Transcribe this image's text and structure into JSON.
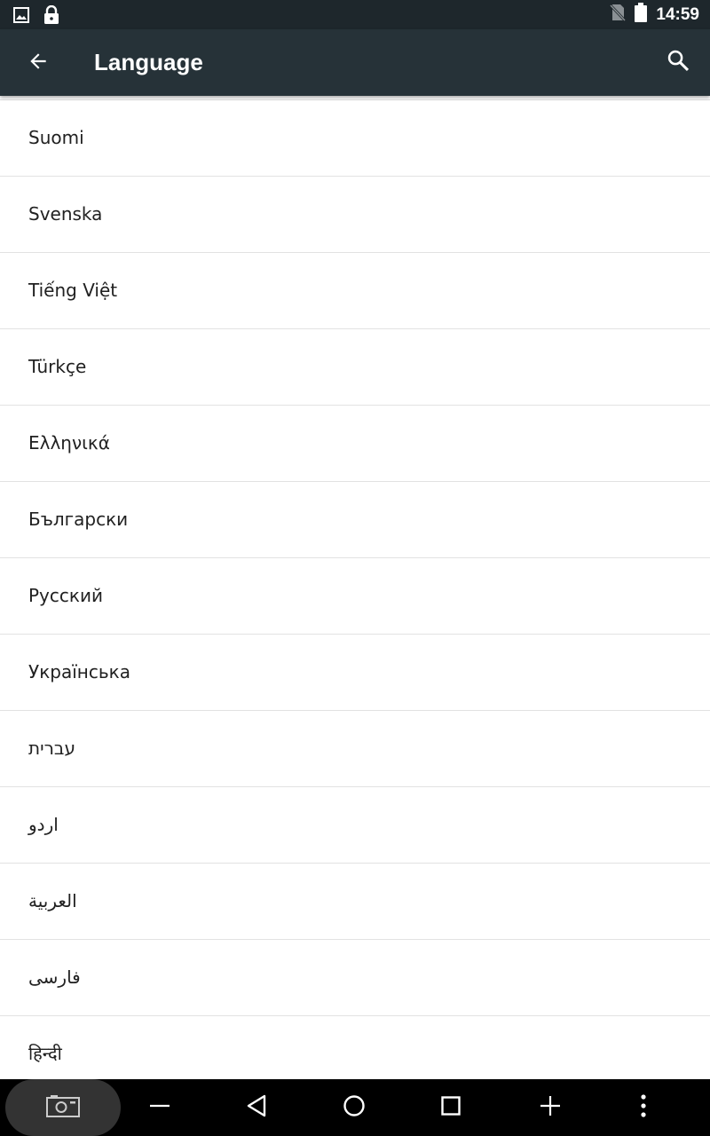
{
  "status_bar": {
    "time": "14:59",
    "left_icons": [
      "image-icon",
      "lock-icon"
    ],
    "right_icons": [
      "no-sim-icon",
      "battery-icon"
    ]
  },
  "app_bar": {
    "title": "Language",
    "back_icon": "arrow-back-icon",
    "search_icon": "search-icon",
    "background": "#263238"
  },
  "languages": [
    "Suomi",
    "Svenska",
    "Tiếng Việt",
    "Türkçe",
    "Ελληνικά",
    "Български",
    "Русский",
    "Українська",
    "עברית",
    "اردو",
    "العربية",
    "فارسی",
    "हिन्दी"
  ],
  "nav_bar": {
    "buttons": [
      "screenshot-icon",
      "volume-down-icon",
      "back-triangle-icon",
      "home-circle-icon",
      "recents-square-icon",
      "volume-up-icon",
      "more-vert-icon"
    ]
  }
}
